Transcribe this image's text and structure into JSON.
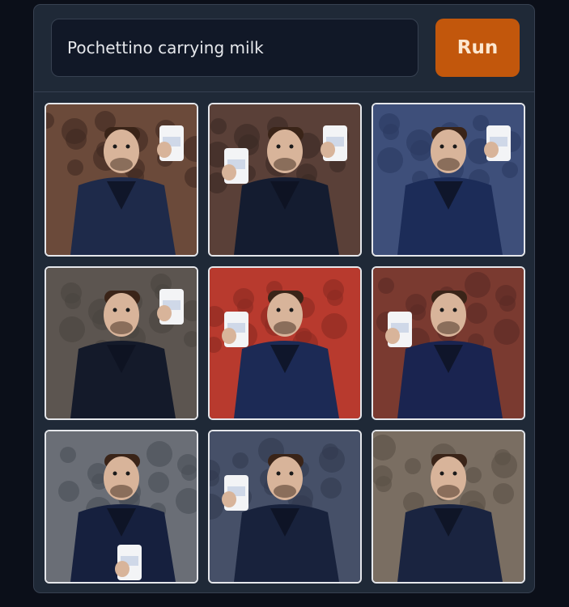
{
  "prompt": {
    "value": "Pochettino carrying milk"
  },
  "run_button": {
    "label": "Run"
  },
  "gallery": {
    "tiles": [
      {
        "name": "generated-image-1",
        "bg": "#6b4a3a",
        "coat": "#1e2a4a",
        "milk_side": "right",
        "accent": "#3f2a22"
      },
      {
        "name": "generated-image-2",
        "bg": "#5a4038",
        "coat": "#141c30",
        "milk_side": "both",
        "accent": "#3a2a25"
      },
      {
        "name": "generated-image-3",
        "bg": "#3e4f7a",
        "coat": "#1c2c58",
        "milk_side": "right",
        "accent": "#2b3a60"
      },
      {
        "name": "generated-image-4",
        "bg": "#5c5550",
        "coat": "#141a2a",
        "milk_side": "right",
        "accent": "#4a4440"
      },
      {
        "name": "generated-image-5",
        "bg": "#b83a2e",
        "coat": "#1c2a55",
        "milk_side": "left",
        "accent": "#8a2a22"
      },
      {
        "name": "generated-image-6",
        "bg": "#7a3a30",
        "coat": "#1a2450",
        "milk_side": "left",
        "accent": "#5a2a25"
      },
      {
        "name": "generated-image-7",
        "bg": "#6a6e76",
        "coat": "#16203e",
        "milk_side": "bottom",
        "accent": "#4a4e56"
      },
      {
        "name": "generated-image-8",
        "bg": "#465068",
        "coat": "#18223c",
        "milk_side": "left",
        "accent": "#323a50"
      },
      {
        "name": "generated-image-9",
        "bg": "#7a6e62",
        "coat": "#1a2440",
        "milk_side": "none",
        "accent": "#5a5046"
      }
    ]
  }
}
